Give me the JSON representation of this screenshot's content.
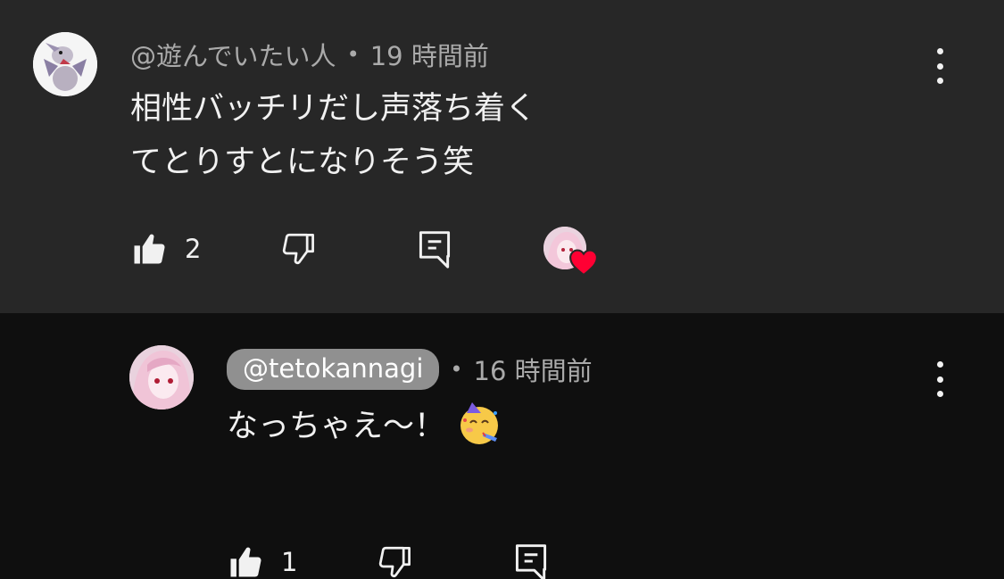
{
  "comments": [
    {
      "author": "@遊んでいたい人",
      "separator": "•",
      "time": "19 時間前",
      "lines": [
        "相性バッチリだし声落ち着く",
        "てとりすとになりそう笑"
      ],
      "likes": "2"
    },
    {
      "author": "@tetokannagi",
      "separator": "•",
      "time": "16 時間前",
      "text": "なっちゃえ〜！",
      "likes": "1"
    }
  ],
  "colors": {
    "top_bg": "#272727",
    "reply_bg": "#0f0f0f",
    "author_pill": "#909090",
    "heart": "#ff0033"
  }
}
